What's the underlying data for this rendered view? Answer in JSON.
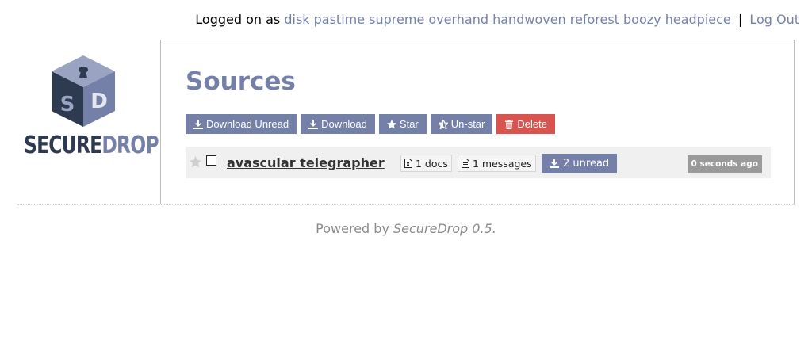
{
  "session": {
    "logged_on_prefix": "Logged on as",
    "username": "disk pastime supreme overhand handwoven reforest boozy headpiece",
    "separator": "|",
    "logout_label": "Log Out"
  },
  "logo": {
    "word_secure": "SECURE",
    "word_drop": "DROP",
    "cube_letters": [
      "S",
      "D"
    ]
  },
  "page": {
    "title": "Sources"
  },
  "actions": [
    {
      "label": "Download Unread",
      "icon": "download-icon"
    },
    {
      "label": "Download",
      "icon": "download-icon"
    },
    {
      "label": "Star",
      "icon": "star-icon"
    },
    {
      "label": "Un-star",
      "icon": "unstar-icon"
    },
    {
      "label": "Delete",
      "icon": "trash-icon"
    }
  ],
  "sources": [
    {
      "name": "avascular telegrapher",
      "docs": "1 docs",
      "messages": "1 messages",
      "unread": "2 unread",
      "last_updated": "0 seconds ago",
      "starred": false,
      "selected": false
    }
  ],
  "footer": {
    "prefix": "Powered by",
    "product": "SecureDrop 0.5."
  },
  "colors": {
    "accent": "#7480a8",
    "danger": "#d9534f",
    "row_bg": "#f0f0f0",
    "time_badge": "#9a9a9a"
  }
}
